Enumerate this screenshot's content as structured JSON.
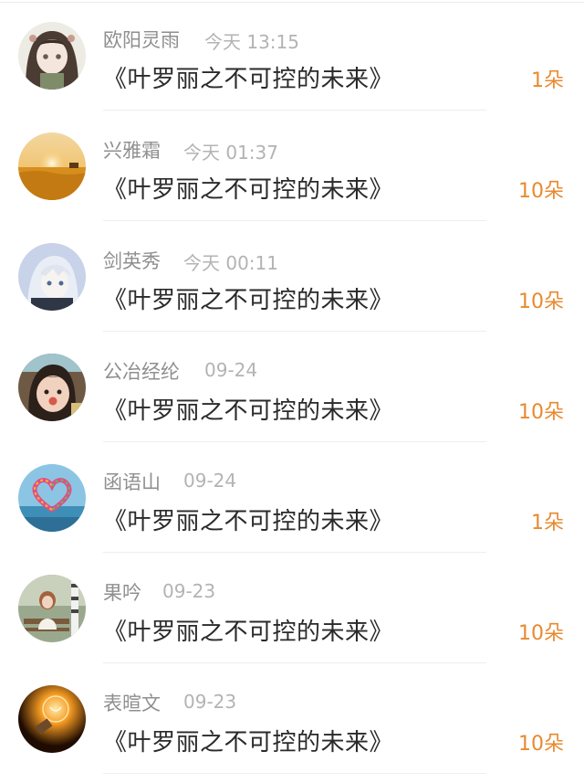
{
  "colors": {
    "count": "#e88a2f",
    "name": "#8f8f8f",
    "time": "#b3b3b3",
    "title": "#2a2a2a"
  },
  "gifts": [
    {
      "user": "欧阳灵雨",
      "time": "今天 13:15",
      "title": "《叶罗丽之不可控的未来》",
      "count": "1朵",
      "avatar": "anime-girl-avatar"
    },
    {
      "user": "兴雅霜",
      "time": "今天 01:37",
      "title": "《叶罗丽之不可控的未来》",
      "count": "10朵",
      "avatar": "sunset-field-avatar"
    },
    {
      "user": "剑英秀",
      "time": "今天 00:11",
      "title": "《叶罗丽之不可控的未来》",
      "count": "10朵",
      "avatar": "anime-boy-avatar"
    },
    {
      "user": "公冶经纶",
      "time": "09-24",
      "title": "《叶罗丽之不可控的未来》",
      "count": "10朵",
      "avatar": "child-photo-avatar"
    },
    {
      "user": "函语山",
      "time": "09-24",
      "title": "《叶罗丽之不可控的未来》",
      "count": "1朵",
      "avatar": "heart-sea-avatar"
    },
    {
      "user": "果吟",
      "time": "09-23",
      "title": "《叶罗丽之不可控的未来》",
      "count": "10朵",
      "avatar": "bench-girl-avatar"
    },
    {
      "user": "表暄文",
      "time": "09-23",
      "title": "《叶罗丽之不可控的未来》",
      "count": "10朵",
      "avatar": "lightbulb-avatar"
    }
  ]
}
